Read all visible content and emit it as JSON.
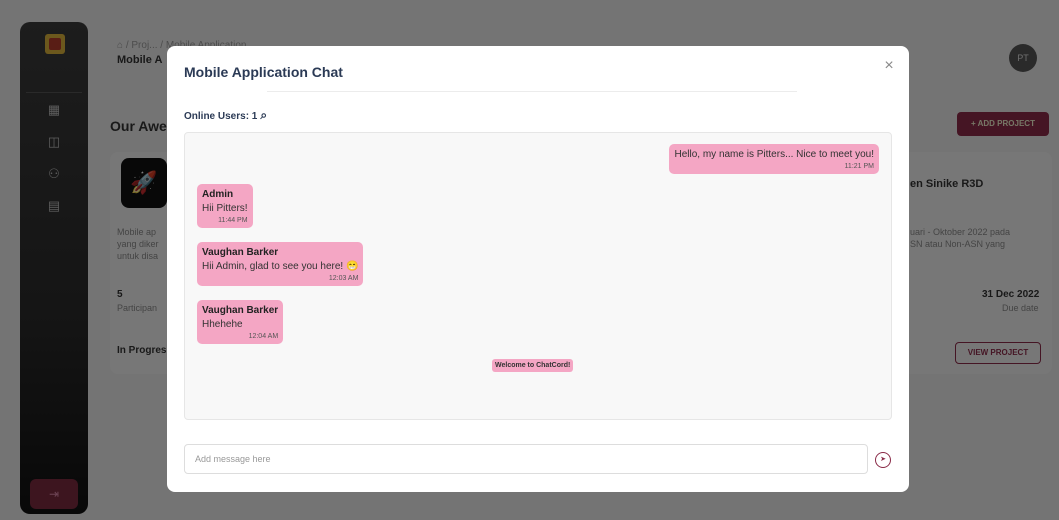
{
  "app": {
    "breadcrumb": "/ Proj... / Mobile Application",
    "subtitle": "Mobile A",
    "avatar": "PT",
    "heading": "Our Awes",
    "add_project": "+ ADD PROJECT",
    "logout_icon": "logout-icon"
  },
  "sidebar": {
    "items": [
      {
        "icon": "dashboard-icon",
        "glyph": "▦"
      },
      {
        "icon": "briefcase-icon",
        "glyph": "◫"
      },
      {
        "icon": "users-icon",
        "glyph": "⚇"
      },
      {
        "icon": "clipboard-icon",
        "glyph": "▤"
      }
    ]
  },
  "card": {
    "left_desc": [
      "Mobile ap",
      "yang diker",
      "untuk disa"
    ],
    "participants_count": "5",
    "participants_label": "Participan",
    "status": "In Progres",
    "right_title": "en Sinike R3D",
    "right_desc": [
      "uari - Oktober 2022 pada",
      "SN atau Non-ASN yang"
    ],
    "due": "31 Dec 2022",
    "due_label": "Due date",
    "view_project": "VIEW PROJECT"
  },
  "modal": {
    "title": "Mobile Application Chat",
    "close": "×",
    "online_users": "Online Users: 1",
    "messages": [
      {
        "side": "right",
        "author": "",
        "text": "Hello, my name is Pitters... Nice to meet you!",
        "time": "11:21 PM"
      },
      {
        "side": "left",
        "author": "Admin",
        "text": "Hii Pitters!",
        "time": "11:44 PM"
      },
      {
        "side": "left",
        "author": "Vaughan Barker",
        "text": "Hii Admin, glad to see you here! 😁",
        "time": "12:03 AM"
      },
      {
        "side": "left",
        "author": "Vaughan Barker",
        "text": "Hhehehe",
        "time": "12:04 AM"
      }
    ],
    "welcome": "Welcome to ChatCord!",
    "input_placeholder": "Add message here",
    "input_value": ""
  },
  "colors": {
    "accent": "#8a2b48",
    "bubble": "#f4a6c4",
    "title": "#2b3a55"
  }
}
